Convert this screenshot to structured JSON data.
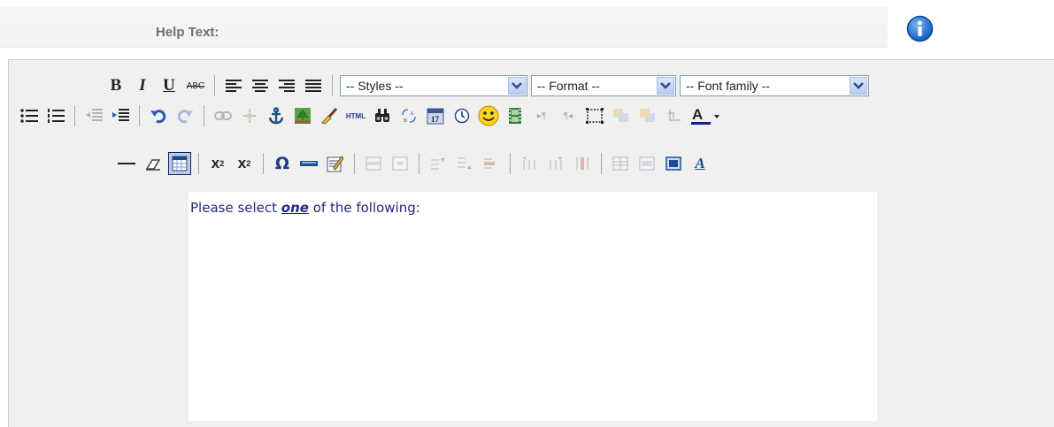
{
  "field": {
    "label": "Help Text:"
  },
  "icons": {
    "info": "info-icon",
    "row1": [
      "bold",
      "italic",
      "underline",
      "strikethrough",
      "align-left",
      "align-center",
      "align-right",
      "align-justify"
    ],
    "row2": [
      "bullet-list",
      "numbered-list",
      "outdent",
      "indent",
      "undo",
      "redo",
      "link",
      "unlink",
      "anchor",
      "image",
      "cleanup",
      "html",
      "search",
      "replace",
      "insert-date",
      "insert-time",
      "emoticon",
      "media",
      "ltr",
      "rtl",
      "visual-aid",
      "layer-forward",
      "layer-backward",
      "absolute",
      "forecolor"
    ],
    "row3": [
      "horizontal-rule",
      "remove-format",
      "visual-aid-toggle",
      "subscript",
      "superscript",
      "special-char",
      "advhr",
      "edit-code",
      "table-row",
      "table-cell",
      "row-before",
      "row-after",
      "delete-row",
      "col-before",
      "col-after",
      "delete-col",
      "split-cells",
      "merge-cells",
      "table-props",
      "style-props"
    ]
  },
  "toolbar": {
    "bold": "B",
    "italic": "I",
    "underline": "U",
    "strike": "ABC",
    "styles_value": "-- Styles --",
    "format_value": "-- Format --",
    "fontfamily_value": "-- Font family --",
    "subscript": "x",
    "superscript": "x",
    "omega": "Ω"
  },
  "content": {
    "text_before": "Please select ",
    "text_emphasis": "one",
    "text_after": " of the following:"
  },
  "colors": {
    "accent": "#1f2a7a",
    "info": "#1f6fd0",
    "forecolor": "#1a1a9c"
  }
}
